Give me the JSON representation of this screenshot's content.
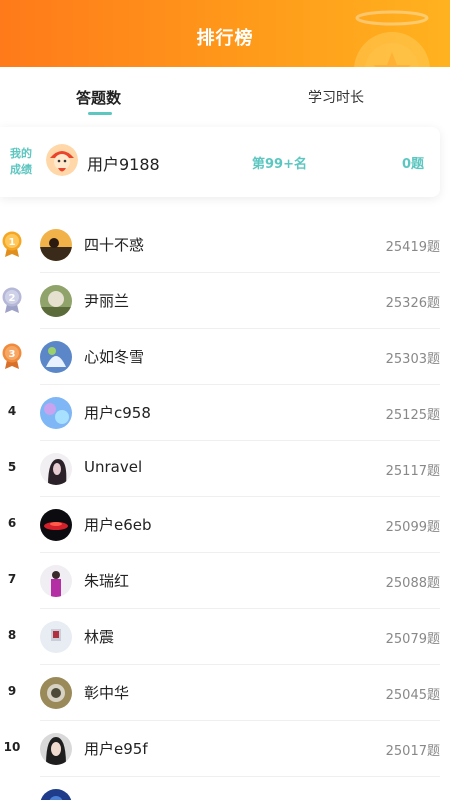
{
  "header": {
    "title": "排行榜"
  },
  "tabs": [
    {
      "label": "答题数",
      "active": true
    },
    {
      "label": "学习时长",
      "active": false
    }
  ],
  "my_score": {
    "label_line1": "我的",
    "label_line2": "成绩",
    "name": "用户9188",
    "rank": "第99+名",
    "count": "0题"
  },
  "ranking": [
    {
      "rank": "1",
      "name": "四十不惑",
      "score": "25419题",
      "medal": "gold"
    },
    {
      "rank": "2",
      "name": "尹丽兰",
      "score": "25326题",
      "medal": "silver"
    },
    {
      "rank": "3",
      "name": "心如冬雪",
      "score": "25303题",
      "medal": "bronze"
    },
    {
      "rank": "4",
      "name": "用户c958",
      "score": "25125题"
    },
    {
      "rank": "5",
      "name": "Unravel",
      "score": "25117题"
    },
    {
      "rank": "6",
      "name": "用户e6eb",
      "score": "25099题"
    },
    {
      "rank": "7",
      "name": "朱瑞红",
      "score": "25088题"
    },
    {
      "rank": "8",
      "name": "林震",
      "score": "25079题"
    },
    {
      "rank": "9",
      "name": "彰中华",
      "score": "25045题"
    },
    {
      "rank": "10",
      "name": "用户e95f",
      "score": "25017题"
    }
  ],
  "colors": {
    "header_orange": "#ff8a1a",
    "accent_teal": "#5cc6c0",
    "gold": "#f5a623",
    "silver": "#b5b8d6",
    "bronze": "#f08a3c"
  }
}
